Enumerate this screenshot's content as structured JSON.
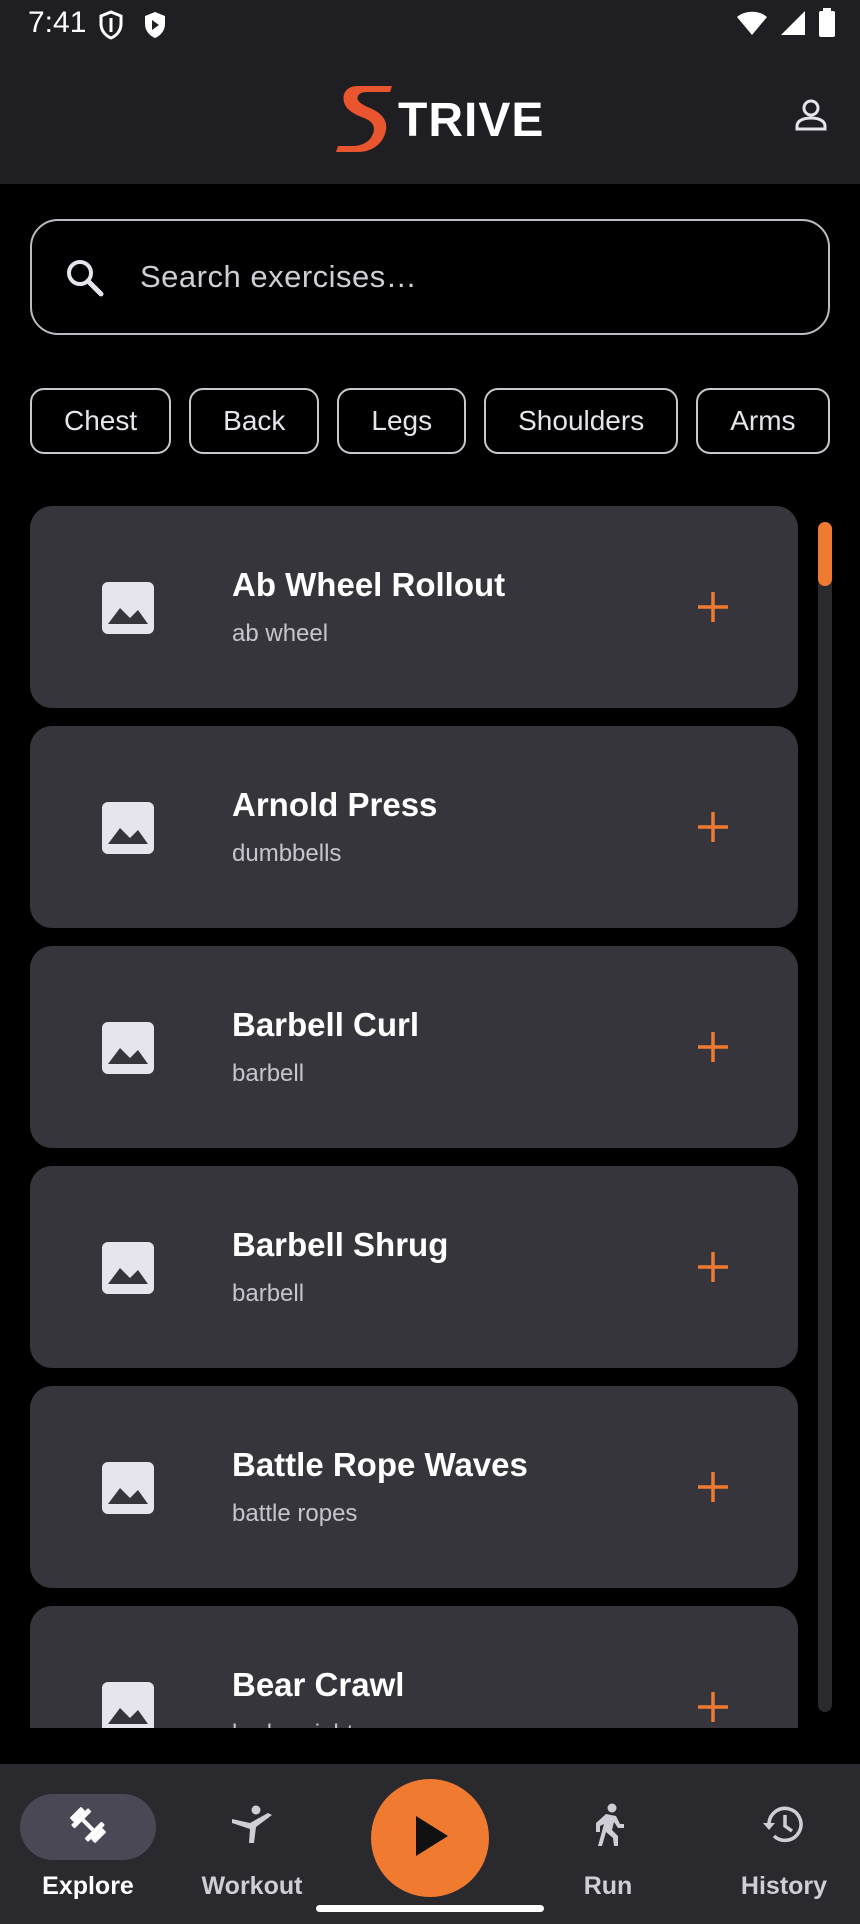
{
  "status_bar": {
    "time": "7:41",
    "left_icons": [
      "shield-outline-icon",
      "shield-play-icon"
    ],
    "right_icons": [
      "wifi-icon",
      "signal-icon",
      "battery-icon"
    ]
  },
  "app_bar": {
    "logo_letter": "S",
    "logo_text": "TRIVE",
    "logo_color": "#E8552E",
    "profile_icon": "person-outline-icon"
  },
  "search": {
    "placeholder": "Search exercises…",
    "icon": "search-icon"
  },
  "filters": {
    "chips": [
      "Chest",
      "Back",
      "Legs",
      "Shoulders",
      "Arms"
    ]
  },
  "exercises": [
    {
      "name": "Ab Wheel Rollout",
      "equipment": "ab wheel"
    },
    {
      "name": "Arnold Press",
      "equipment": "dumbbells"
    },
    {
      "name": "Barbell Curl",
      "equipment": "barbell"
    },
    {
      "name": "Barbell Shrug",
      "equipment": "barbell"
    },
    {
      "name": "Battle Rope Waves",
      "equipment": "battle ropes"
    },
    {
      "name": "Bear Crawl",
      "equipment": "bodyweight"
    }
  ],
  "scrollbar": {
    "position_fraction": 0.0
  },
  "bottom_nav": {
    "items": [
      {
        "label": "Explore",
        "icon": "dumbbell-icon",
        "active": true
      },
      {
        "label": "Workout",
        "icon": "yoga-pose-icon",
        "active": false
      },
      {
        "label": "Run",
        "icon": "running-person-icon",
        "active": false
      },
      {
        "label": "History",
        "icon": "history-clock-icon",
        "active": false
      }
    ],
    "center_button_icon": "play-icon"
  },
  "colors": {
    "accent": "#F07A30",
    "background": "#000000",
    "surface": "#37353C",
    "bar": "#1F1E22"
  }
}
